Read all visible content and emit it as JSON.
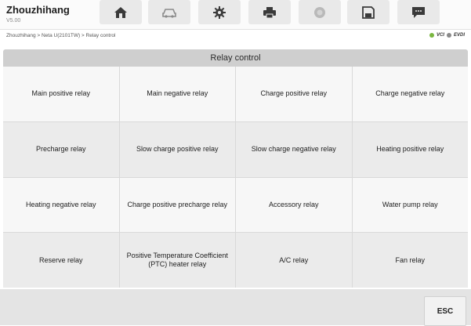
{
  "header": {
    "app_name": "Zhouzhihang",
    "version": "V5.00",
    "toolbar": [
      {
        "icon": "home-icon"
      },
      {
        "icon": "car-vehicle-icon"
      },
      {
        "icon": "gear-icon"
      },
      {
        "icon": "printer-icon"
      },
      {
        "icon": "help-icon"
      },
      {
        "icon": "save-icon"
      },
      {
        "icon": "message-icon"
      }
    ]
  },
  "breadcrumb": "Zhouzhihang > Neta U(2101TW) > Relay control",
  "status": {
    "vci_label": "VCI",
    "evdi_label": "EVDI"
  },
  "section": {
    "title": "Relay control"
  },
  "relays": [
    "Main positive relay",
    "Main negative relay",
    "Charge positive relay",
    "Charge negative relay",
    "Precharge relay",
    "Slow charge positive relay",
    "Slow charge negative relay",
    "Heating positive relay",
    "Heating negative relay",
    "Charge positive precharge relay",
    "Accessory relay",
    "Water pump relay",
    "Reserve relay",
    "Positive Temperature Coefficient (PTC) heater relay",
    "A/C relay",
    "Fan relay"
  ],
  "footer": {
    "esc_label": "ESC"
  },
  "colors": {
    "status_green": "#7ab640",
    "header_bg": "#cfcfcf"
  }
}
